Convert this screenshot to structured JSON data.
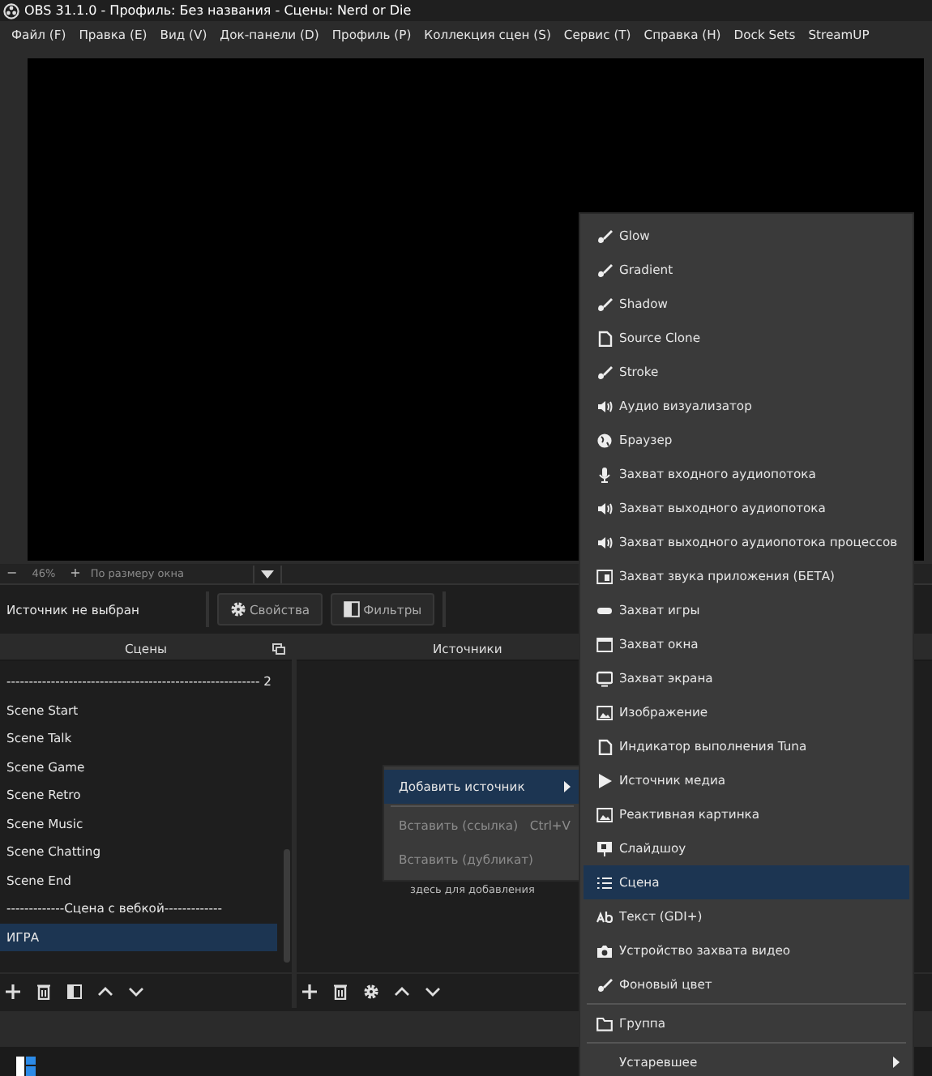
{
  "window": {
    "title": "OBS 31.1.0 - Профиль: Без названия - Сцены: Nerd or Die"
  },
  "menu_bar": [
    "Файл (F)",
    "Правка (E)",
    "Вид (V)",
    "Док-панели (D)",
    "Профиль (P)",
    "Коллекция сцен (S)",
    "Сервис (T)",
    "Справка (H)",
    "Dock Sets",
    "StreamUP"
  ],
  "preview_controls": {
    "zoom_out": "−",
    "zoom": "46%",
    "zoom_in": "+",
    "scale_mode": "По размеру окна"
  },
  "source_toolbar": {
    "status": "Источник не выбран",
    "buttons": [
      {
        "label": "Свойства",
        "kind": "gear"
      },
      {
        "label": "Фильтры",
        "kind": "filter"
      }
    ]
  },
  "scenes_dock": {
    "title": "Сцены",
    "items": [
      {
        "label": "--------------------------------------------------------- 2",
        "selected": false
      },
      {
        "label": "Scene Start",
        "selected": false
      },
      {
        "label": "Scene Talk",
        "selected": false
      },
      {
        "label": "Scene Game",
        "selected": false
      },
      {
        "label": "Scene Retro",
        "selected": false
      },
      {
        "label": "Scene Music",
        "selected": false
      },
      {
        "label": "Scene Chatting",
        "selected": false
      },
      {
        "label": "Scene End",
        "selected": false
      },
      {
        "label": "-------------Сцена  с вебкой-------------",
        "selected": false
      },
      {
        "label": "ИГРА",
        "selected": true
      }
    ]
  },
  "sources_dock": {
    "title": "Источники",
    "hint": "здесь для добавления"
  },
  "context_menu": {
    "items": [
      {
        "kind": "item",
        "label": "Добавить источник",
        "selected": true,
        "disabled": false,
        "submenu": true
      },
      {
        "kind": "separator"
      },
      {
        "kind": "item",
        "label": "Вставить (ссылка)",
        "shortcut": "Ctrl+V",
        "selected": false,
        "disabled": true,
        "submenu": false
      },
      {
        "kind": "item",
        "label": "Вставить (дубликат)",
        "selected": false,
        "disabled": true,
        "submenu": false
      }
    ]
  },
  "submenu": {
    "items": [
      {
        "kind": "brush",
        "label": "Glow",
        "selected": false
      },
      {
        "kind": "brush",
        "label": "Gradient",
        "selected": false
      },
      {
        "kind": "brush",
        "label": "Shadow",
        "selected": false
      },
      {
        "kind": "file",
        "label": "Source Clone",
        "selected": false
      },
      {
        "kind": "brush",
        "label": "Stroke",
        "selected": false
      },
      {
        "kind": "speaker",
        "label": "Аудио визуализатор",
        "selected": false
      },
      {
        "kind": "globe",
        "label": "Браузер",
        "selected": false
      },
      {
        "kind": "mic",
        "label": "Захват входного аудиопотока",
        "selected": false
      },
      {
        "kind": "speaker",
        "label": "Захват выходного аудиопотока",
        "selected": false
      },
      {
        "kind": "speaker",
        "label": "Захват выходного аудиопотока процессов",
        "selected": false
      },
      {
        "kind": "app",
        "label": "Захват звука приложения (БЕТА)",
        "selected": false
      },
      {
        "kind": "gamepad",
        "label": "Захват игры",
        "selected": false
      },
      {
        "kind": "window",
        "label": "Захват окна",
        "selected": false
      },
      {
        "kind": "monitor",
        "label": "Захват экрана",
        "selected": false
      },
      {
        "kind": "image",
        "label": "Изображение",
        "selected": false
      },
      {
        "kind": "file",
        "label": "Индикатор выполнения Tuna",
        "selected": false
      },
      {
        "kind": "play",
        "label": "Источник медиа",
        "selected": false
      },
      {
        "kind": "image",
        "label": "Реактивная картинка",
        "selected": false
      },
      {
        "kind": "slideshow",
        "label": "Слайдшоу",
        "selected": false
      },
      {
        "kind": "list",
        "label": "Сцена",
        "selected": true
      },
      {
        "kind": "text",
        "label": "Текст (GDI+)",
        "selected": false
      },
      {
        "kind": "camera",
        "label": "Устройство захвата видео",
        "selected": false
      },
      {
        "kind": "brush",
        "label": "Фоновый цвет",
        "selected": false
      },
      {
        "kind": "separator"
      },
      {
        "kind": "folder",
        "label": "Группа",
        "selected": false
      },
      {
        "kind": "separator"
      },
      {
        "kind": "none",
        "label": "Устаревшее",
        "selected": false,
        "submenu": true
      }
    ]
  }
}
